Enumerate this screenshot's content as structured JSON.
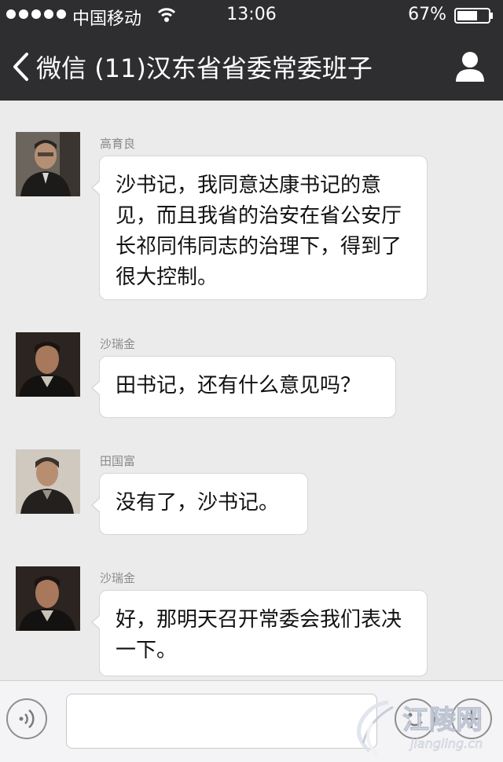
{
  "status_bar": {
    "carrier": "中国移动",
    "time": "13:06",
    "battery": "67%",
    "battery_level": 0.67,
    "signal_dots": 5
  },
  "nav": {
    "back_label": "微信",
    "title": "(11)汉东省省委常委班子"
  },
  "messages": [
    {
      "sender": "高育良",
      "text": "沙书记，我同意达康书记的意见，而且我省的治安在省公安厅长祁同伟同志的治理下，得到了很大控制。"
    },
    {
      "sender": "沙瑞金",
      "text": "田书记，还有什么意见吗？"
    },
    {
      "sender": "田国富",
      "text": "没有了，沙书记。"
    },
    {
      "sender": "沙瑞金",
      "text": "好，那明天召开常委会我们表决一下。"
    }
  ],
  "input": {
    "value": ""
  },
  "watermark": {
    "text": "江陵网",
    "sub": "jiangling.cn"
  },
  "colors": {
    "bar": "#2e2e30",
    "background": "#ebebeb",
    "bubble": "#ffffff"
  }
}
